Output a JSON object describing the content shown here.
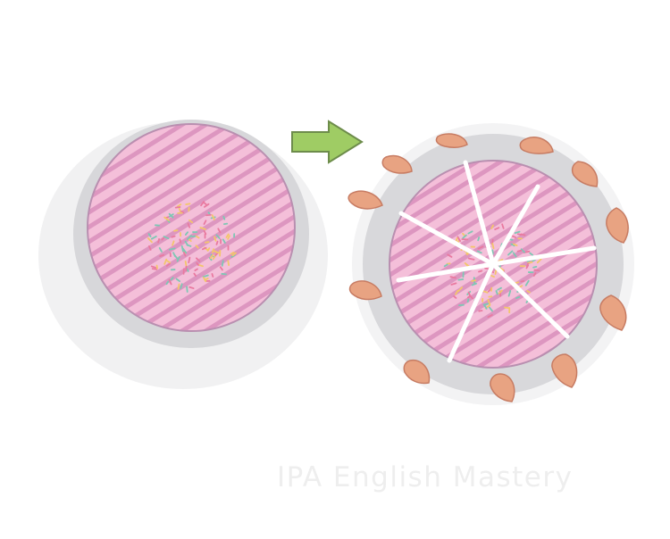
{
  "illustration": {
    "left_scene": "whole-cake",
    "arrow": "arrow-right-icon",
    "right_scene": "sliced-cake-with-hands"
  },
  "colors": {
    "cake_pink": "#f2b4d6",
    "cake_stripe": "#d98ebc",
    "plate_gray": "#cfcfd2",
    "arrow_green": "#9fcc64",
    "skin": "#e8a382",
    "sprinkle_1": "#7ec7b4",
    "sprinkle_2": "#e97aa0",
    "sprinkle_3": "#f3c66b"
  },
  "watermark": {
    "text": "IPA English Mastery"
  }
}
